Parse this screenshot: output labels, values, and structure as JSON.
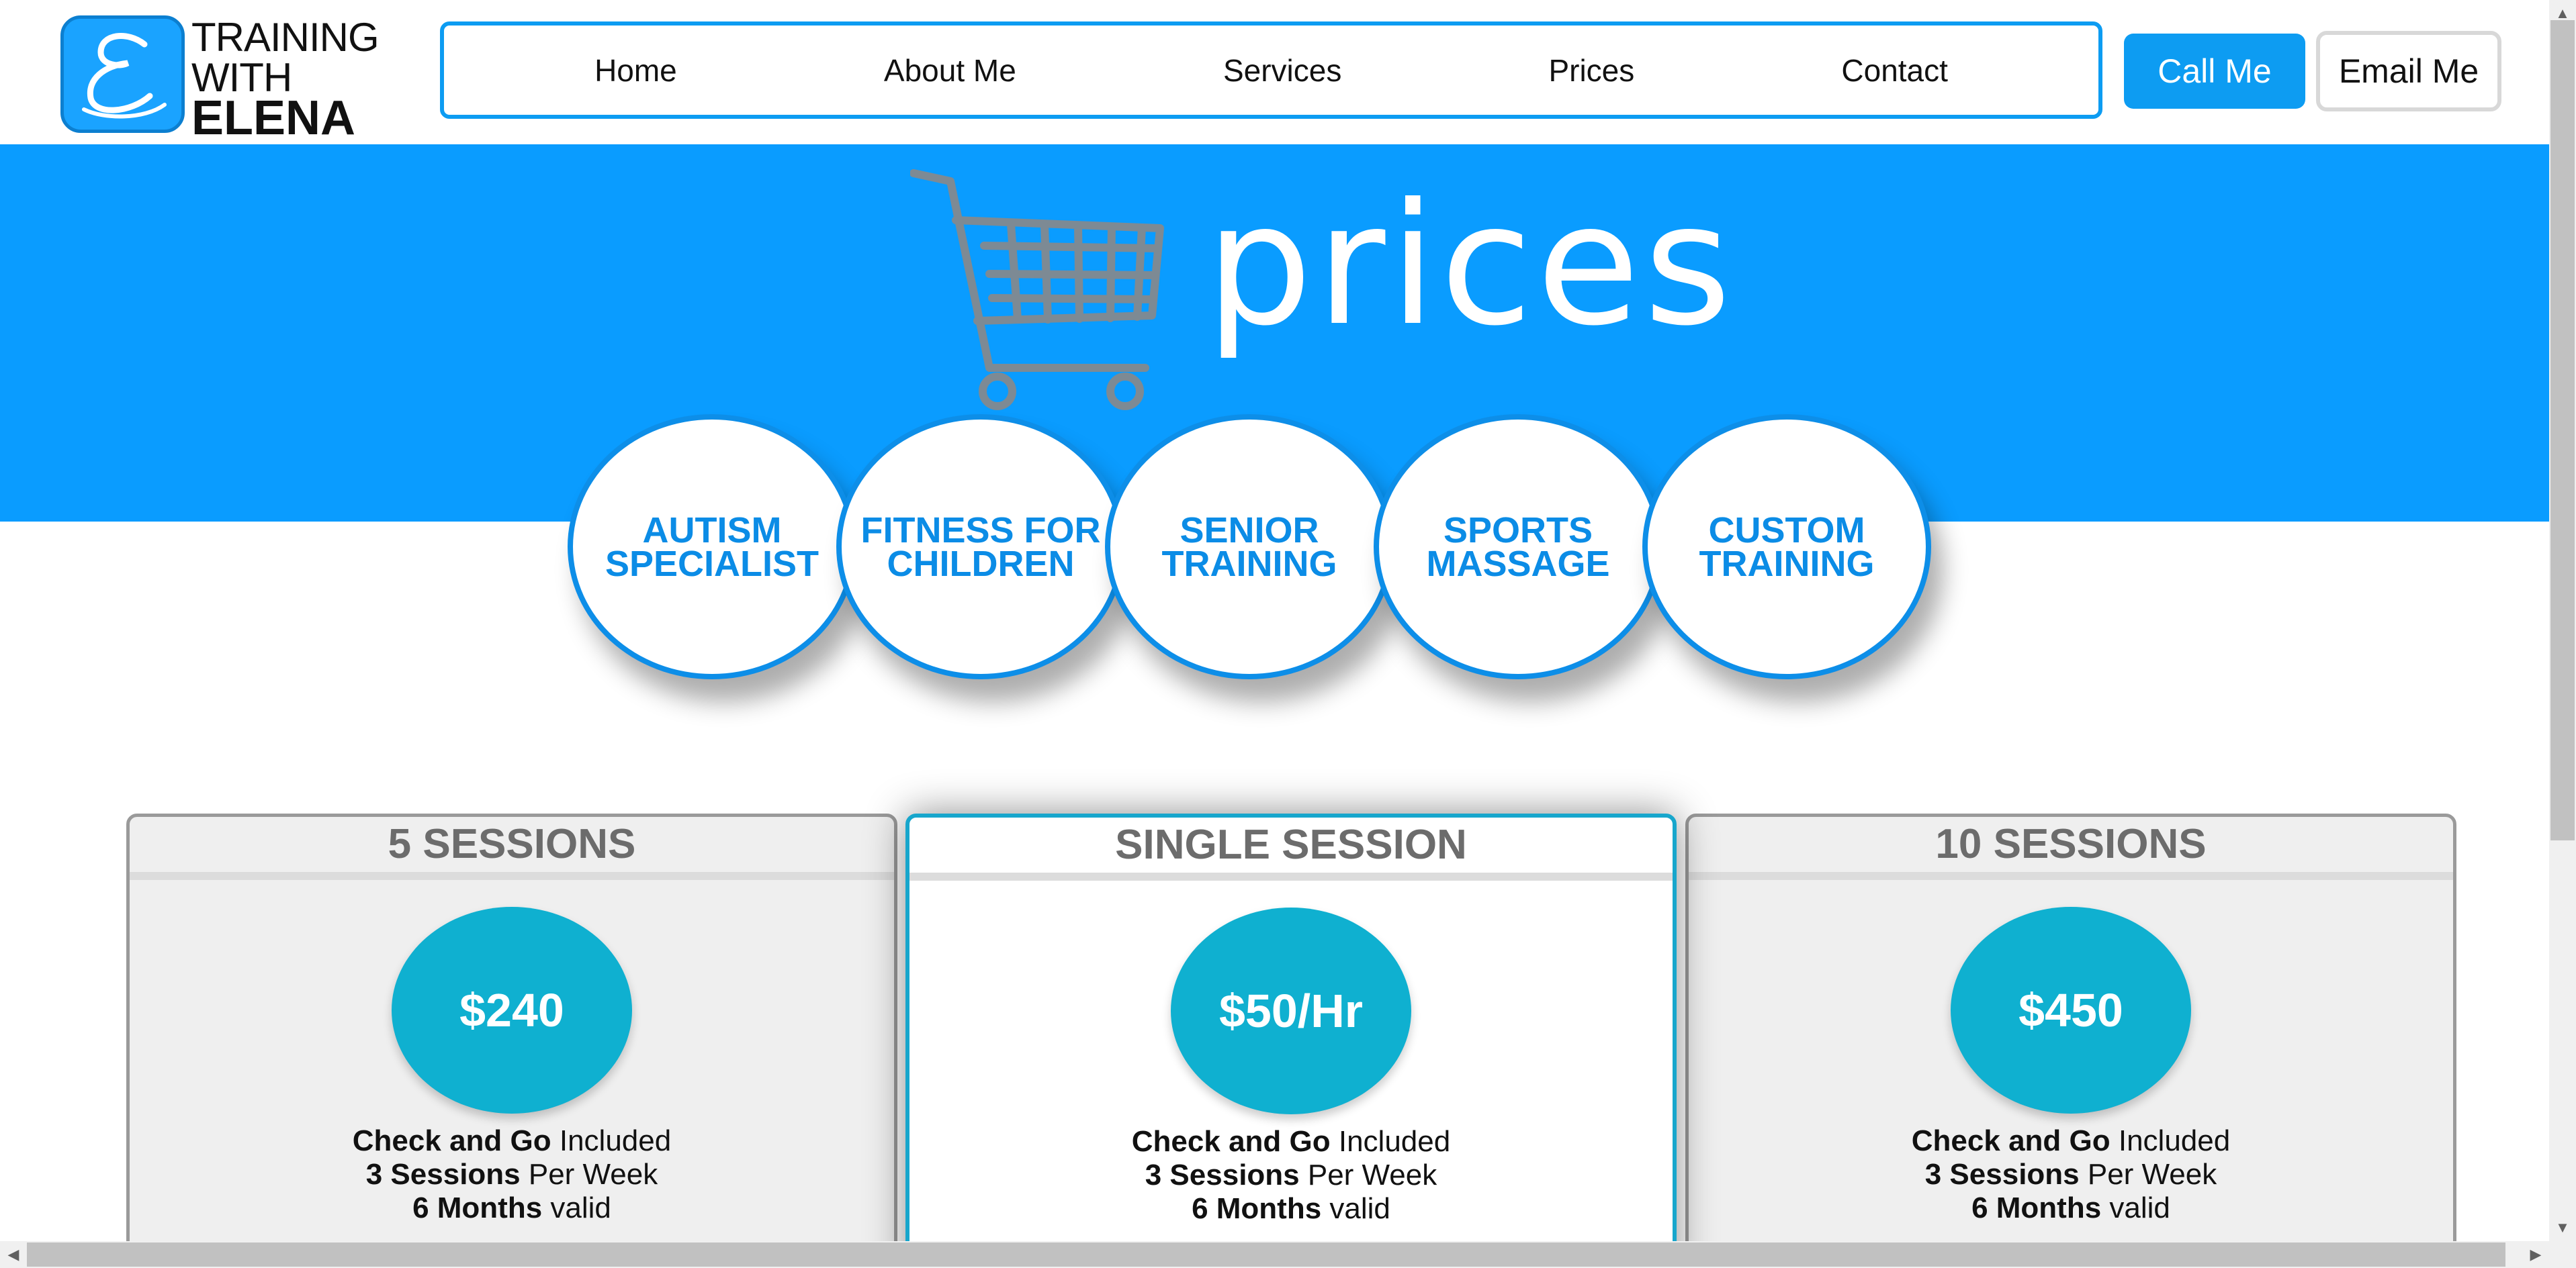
{
  "brand": {
    "line1": "TRAINING",
    "line2": "WITH",
    "line3": "ELENA",
    "logo_icon": "script-e-logo-icon",
    "accent_color": "#0a9cff"
  },
  "nav": {
    "items": [
      "Home",
      "About Me",
      "Services",
      "Prices",
      "Contact"
    ]
  },
  "actions": {
    "call_label": "Call Me",
    "email_label": "Email Me"
  },
  "banner": {
    "title": "prices",
    "icon": "shopping-cart-icon"
  },
  "services": [
    {
      "line1": "AUTISM",
      "line2": "SPECIALIST"
    },
    {
      "line1": "FITNESS FOR",
      "line2": "CHILDREN"
    },
    {
      "line1": "SENIOR",
      "line2": "TRAINING"
    },
    {
      "line1": "SPORTS",
      "line2": "MASSAGE"
    },
    {
      "line1": "CUSTOM",
      "line2": "TRAINING"
    }
  ],
  "pricing": [
    {
      "title": "5 SESSIONS",
      "price": "$240",
      "features": [
        {
          "bold": "Check and Go",
          "rest": " Included"
        },
        {
          "bold": "3 Sessions",
          "rest": " Per Week"
        },
        {
          "bold": "6 Months",
          "rest": " valid"
        }
      ]
    },
    {
      "title": "SINGLE SESSION",
      "price": "$50/Hr",
      "features": [
        {
          "bold": "Check and Go",
          "rest": " Included"
        },
        {
          "bold": "3 Sessions",
          "rest": " Per Week"
        },
        {
          "bold": "6 Months",
          "rest": " valid"
        }
      ]
    },
    {
      "title": "10 SESSIONS",
      "price": "$450",
      "features": [
        {
          "bold": "Check and Go",
          "rest": " Included"
        },
        {
          "bold": "3 Sessions",
          "rest": " Per Week"
        },
        {
          "bold": "6 Months",
          "rest": " valid"
        }
      ]
    }
  ]
}
